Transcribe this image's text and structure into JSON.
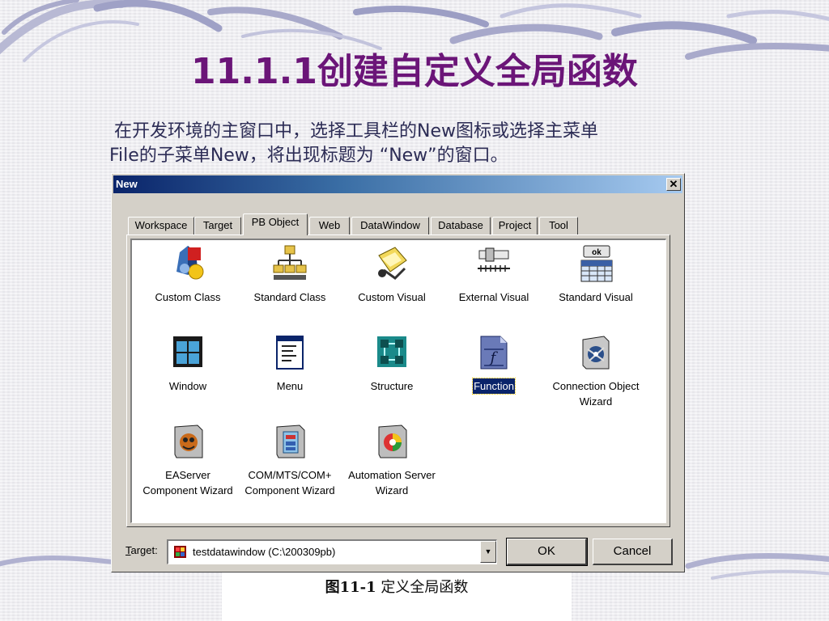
{
  "slide": {
    "title_num": "11.1.1",
    "title_text": "创建自定义全局函数",
    "body_line1": "在开发环境的主窗口中，选择工具栏的New图标或选择主菜单",
    "body_line2": "File的子菜单New，将出现标题为 “New”的窗口。",
    "caption_prefix": "图11-1",
    "caption_text": " 定义全局函数"
  },
  "dialog": {
    "title": "New",
    "close_symbol": "✕",
    "tabs": [
      {
        "label": "Workspace"
      },
      {
        "label": "Target"
      },
      {
        "label": "PB Object",
        "active": true
      },
      {
        "label": "Web"
      },
      {
        "label": "DataWindow"
      },
      {
        "label": "Database"
      },
      {
        "label": "Project"
      },
      {
        "label": "Tool"
      }
    ],
    "items": [
      {
        "label": "Custom Class",
        "icon": "custom-class-icon"
      },
      {
        "label": "Standard Class",
        "icon": "standard-class-icon"
      },
      {
        "label": "Custom Visual",
        "icon": "custom-visual-icon"
      },
      {
        "label": "External Visual",
        "icon": "external-visual-icon"
      },
      {
        "label": "Standard Visual",
        "icon": "standard-visual-icon"
      },
      {
        "label": "Window",
        "icon": "window-icon"
      },
      {
        "label": "Menu",
        "icon": "menu-icon"
      },
      {
        "label": "Structure",
        "icon": "structure-icon"
      },
      {
        "label": "Function",
        "icon": "function-icon",
        "selected": true
      },
      {
        "label": "Connection Object Wizard",
        "icon": "connection-wizard-icon"
      },
      {
        "label": "EAServer Component Wizard",
        "icon": "easerver-wizard-icon"
      },
      {
        "label": "COM/MTS/COM+ Component Wizard",
        "icon": "com-wizard-icon"
      },
      {
        "label": "Automation Server Wizard",
        "icon": "automation-wizard-icon"
      }
    ],
    "standard_visual_ok": "ok",
    "target_label_mnemonic": "T",
    "target_label_rest": "arget:",
    "target_value": "testdatawindow (C:\\200309pb)",
    "combo_arrow": "▼",
    "ok_label": "OK",
    "cancel_label": "Cancel"
  }
}
